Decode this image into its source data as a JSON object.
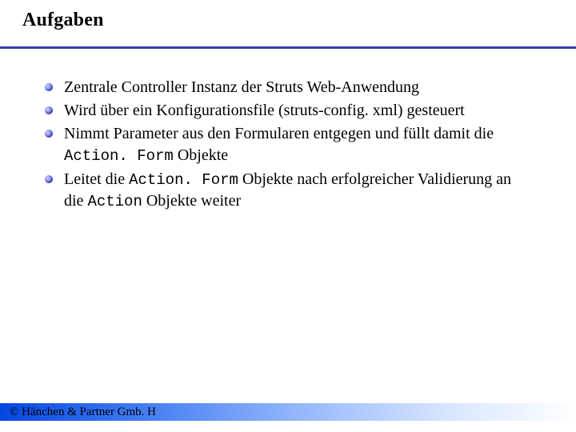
{
  "title": "Aufgaben",
  "bullets": [
    {
      "segments": [
        {
          "t": "Zentrale Controller Instanz der Struts Web-Anwendung"
        }
      ]
    },
    {
      "segments": [
        {
          "t": "Wird über ein Konfigurationsfile (struts-config. xml) gesteuert"
        }
      ]
    },
    {
      "segments": [
        {
          "t": "Nimmt Parameter aus den Formularen entgegen und füllt damit die "
        },
        {
          "t": "Action. Form",
          "mono": true
        },
        {
          "t": " Objekte"
        }
      ]
    },
    {
      "segments": [
        {
          "t": "Leitet die "
        },
        {
          "t": "Action. Form",
          "mono": true
        },
        {
          "t": " Objekte nach erfolgreicher Validierung an die "
        },
        {
          "t": "Action",
          "mono": true
        },
        {
          "t": " Objekte weiter"
        }
      ]
    }
  ],
  "footer": "© Hänchen & Partner Gmb. H"
}
